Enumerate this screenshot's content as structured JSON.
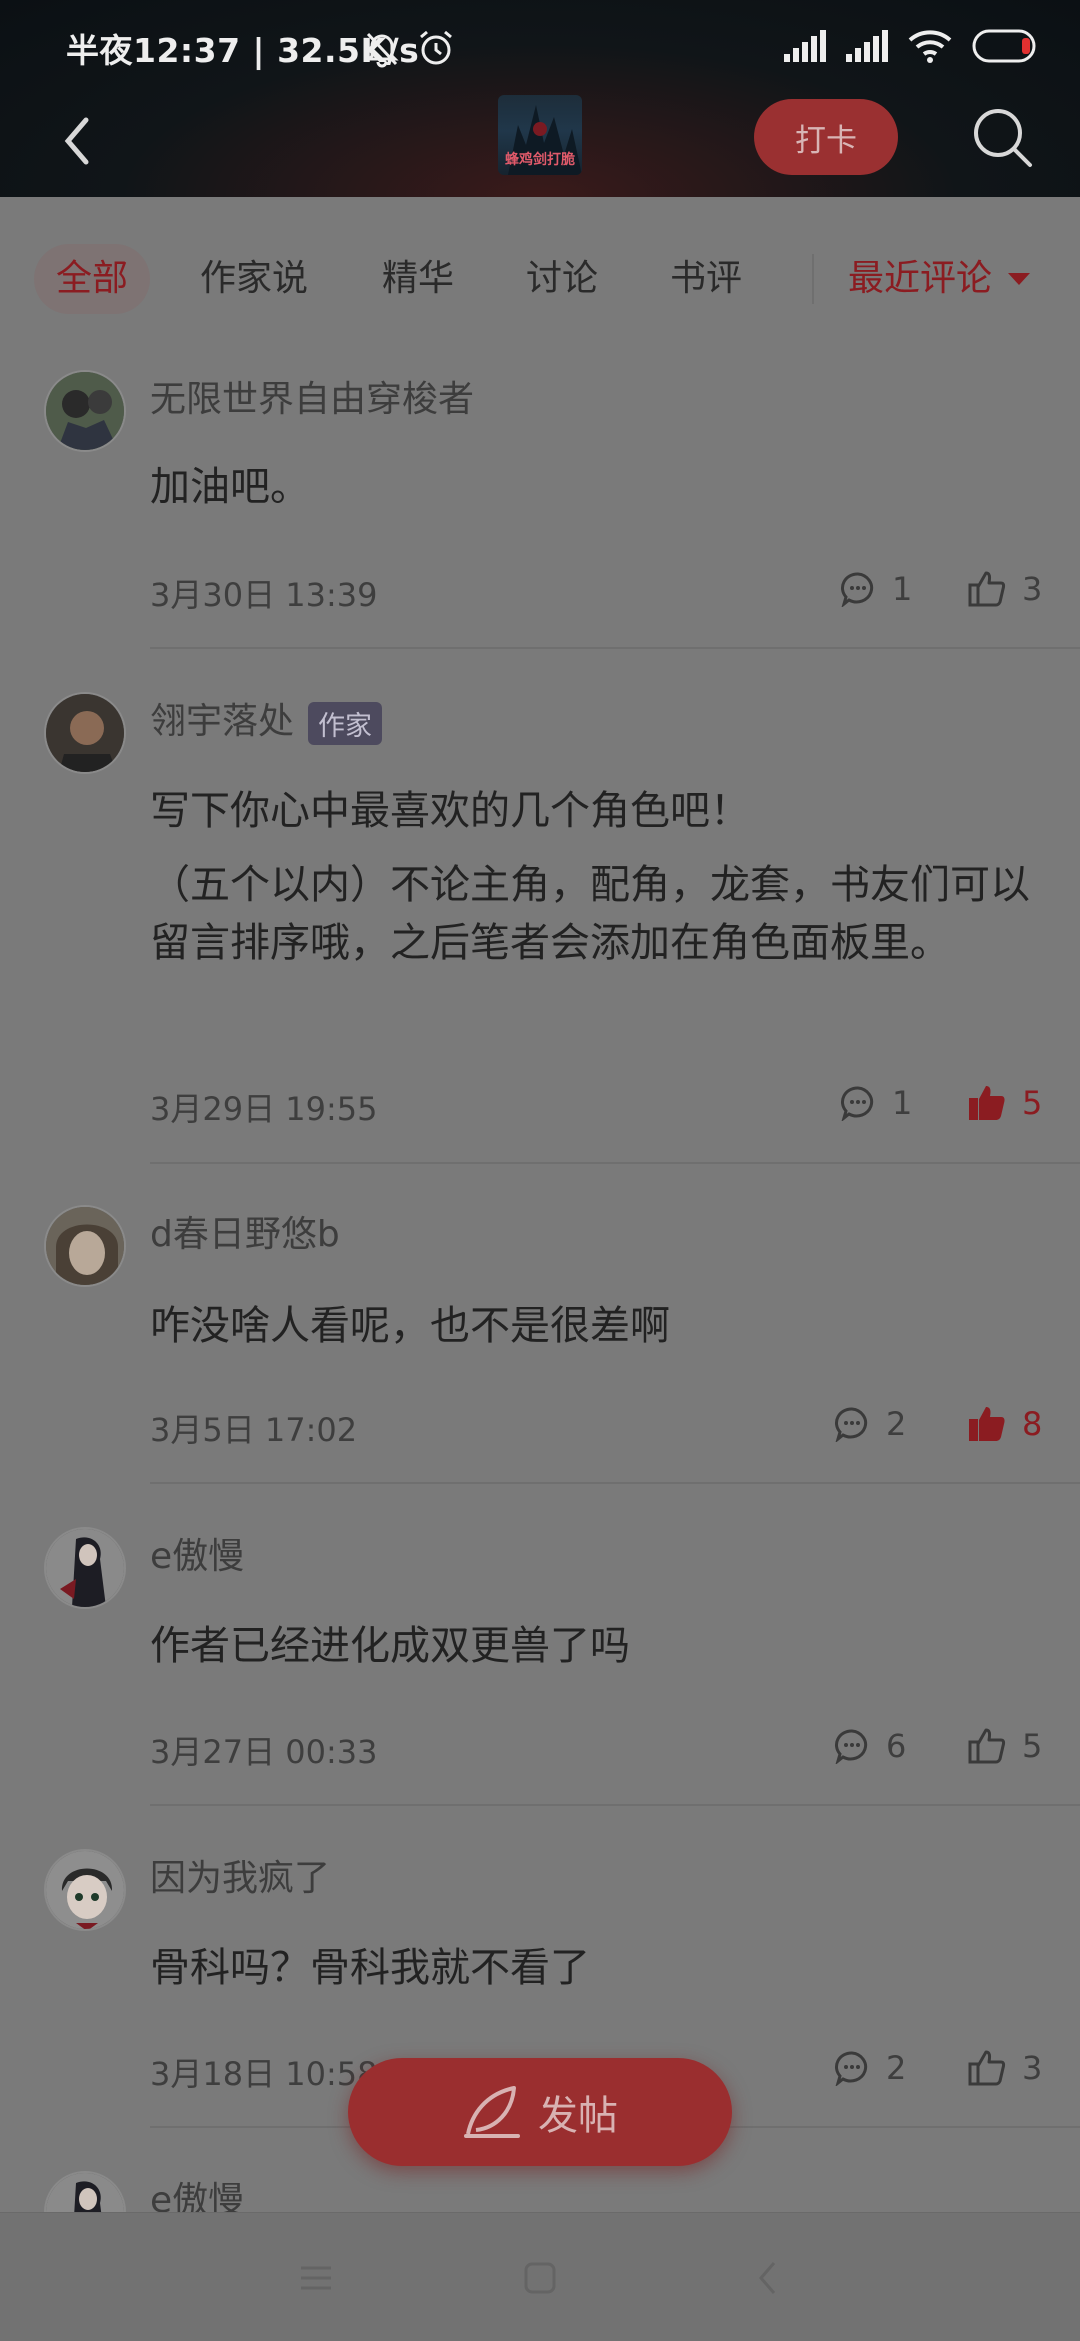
{
  "status_bar": {
    "text": "半夜12:37 | 32.5K/s",
    "icons": [
      "mute-bell-icon",
      "alarm-icon",
      "signal-icon",
      "signal-icon",
      "wifi-icon",
      "battery-icon"
    ]
  },
  "header": {
    "cover_text": "蜂鸡剑打脆",
    "checkin_label": "打卡"
  },
  "tabs": [
    {
      "label": "全部",
      "active": true
    },
    {
      "label": "作家说",
      "active": false
    },
    {
      "label": "精华",
      "active": false
    },
    {
      "label": "讨论",
      "active": false
    },
    {
      "label": "书评",
      "active": false
    }
  ],
  "sort": {
    "label": "最近评论"
  },
  "posts": [
    {
      "author": "无限世界自由穿梭者",
      "badge": "",
      "content": "加油吧。",
      "date": "3月30日 13:39",
      "comments": "1",
      "likes": "3",
      "liked": false
    },
    {
      "author": "翎宇落处",
      "badge": "作家",
      "content_lines": [
        "写下你心中最喜欢的几个角色吧！",
        "（五个以内）不论主角，配角，龙套，书友们可以留言排序哦，之后笔者会添加在角色面板里。"
      ],
      "date": "3月29日 19:55",
      "comments": "1",
      "likes": "5",
      "liked": true
    },
    {
      "author": "d春日野悠b",
      "badge": "",
      "content": "咋没啥人看呢，也不是很差啊",
      "date": "3月5日 17:02",
      "comments": "2",
      "likes": "8",
      "liked": true
    },
    {
      "author": "e傲慢",
      "badge": "",
      "content": "作者已经进化成双更兽了吗",
      "date": "3月27日 00:33",
      "comments": "6",
      "likes": "5",
      "liked": false
    },
    {
      "author": "因为我疯了",
      "badge": "",
      "content": "骨科吗？骨科我就不看了",
      "date": "3月18日 10:58",
      "comments": "2",
      "likes": "3",
      "liked": false
    },
    {
      "author": "e傲慢",
      "badge": "",
      "content": "",
      "date": "",
      "comments": "",
      "likes": "",
      "liked": false
    }
  ],
  "fab": {
    "label": "发帖"
  },
  "colors": {
    "accent": "#8b1c21",
    "overlay": "#7a7a7a",
    "header": "#0b1014"
  }
}
